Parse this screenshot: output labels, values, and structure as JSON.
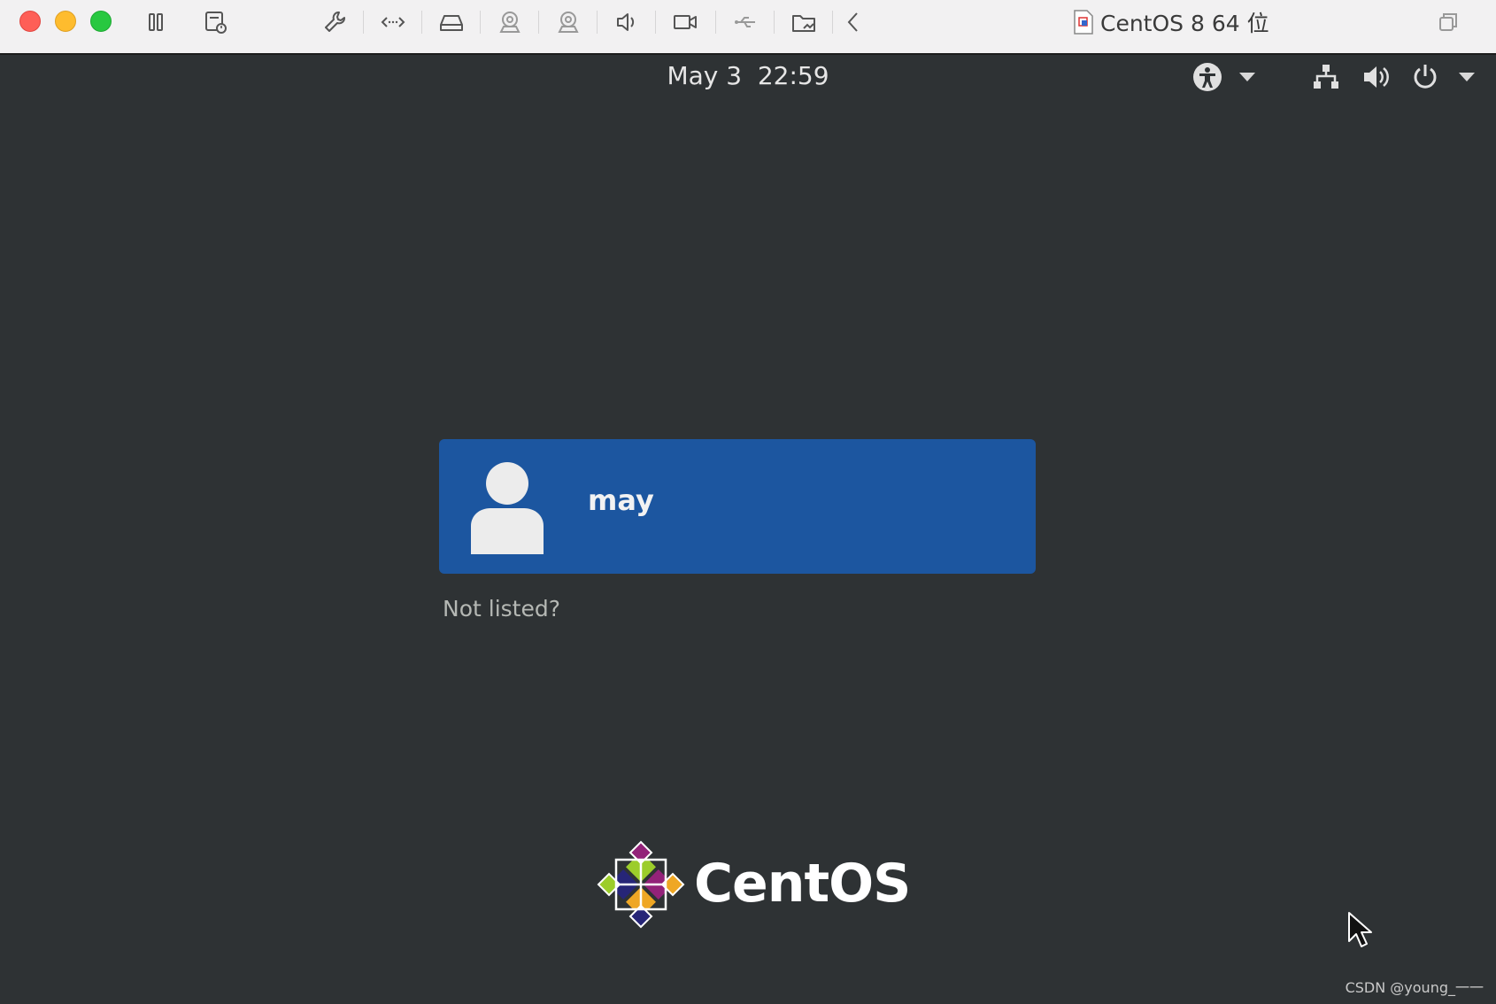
{
  "window": {
    "title": "CentOS 8 64 位"
  },
  "toolbar": {
    "icons": [
      "pause-icon",
      "snapshot-icon",
      "settings-wrench-icon",
      "network-adapter-icon",
      "hard-disk-icon",
      "camera-icon",
      "camera-icon",
      "sound-icon",
      "video-camera-icon",
      "usb-icon",
      "shared-folder-icon",
      "chevron-left-icon",
      "window-restore-icon"
    ]
  },
  "topbar": {
    "date": "May 3",
    "time": "22:59"
  },
  "login": {
    "user_name": "may",
    "not_listed": "Not listed?"
  },
  "brand": {
    "logo_text": "CentOS"
  },
  "watermark": "CSDN @young_一一",
  "colors": {
    "toolbar_bg": "#f2f1f2",
    "screen_bg": "#2e3234",
    "user_card": "#1c56a0",
    "close": "#fe5f57",
    "minimize": "#febc2e",
    "zoom": "#28c840"
  }
}
